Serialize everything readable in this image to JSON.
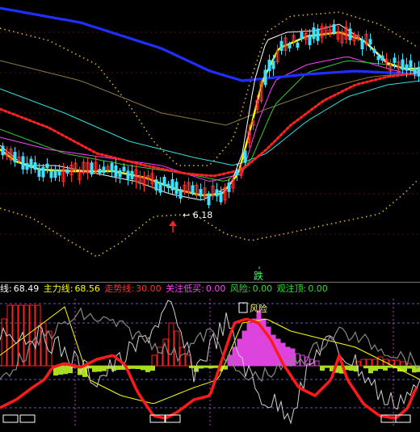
{
  "chart_data": [
    {
      "type": "candlestick",
      "panel": "price",
      "annotations": {
        "low_price_label": "6.18",
        "marker_label": "跌"
      },
      "colors": {
        "up": "#ff3333",
        "down": "#40e0ff",
        "ma_long": "#1f2fff",
        "ma_yellow": "#ffff00",
        "ma_white": "#ffffff",
        "ma_magenta": "#ff40ff",
        "ma_green": "#33cc33",
        "ma_cyan": "#33dddd",
        "dots_red": "#ff2222",
        "dots_yellow": "#d9b030"
      }
    },
    {
      "type": "line",
      "panel": "indicator",
      "legend": [
        {
          "label": "线:",
          "value": "68.49",
          "color": "#ffffff"
        },
        {
          "label": "主力线:",
          "value": "68.56",
          "color": "#ffff00"
        },
        {
          "label": "走势线:",
          "value": "30.00",
          "color": "#ff3030"
        },
        {
          "label": "关注低买:",
          "value": "0.00",
          "color": "#ff40ff"
        },
        {
          "label": "风险:",
          "value": "0.00",
          "color": "#33dd33"
        },
        {
          "label": "观注顶:",
          "value": "0.00",
          "color": "#33dd33"
        }
      ],
      "annotations": {
        "risk_label": "风险"
      },
      "ylim": [
        0,
        100
      ]
    }
  ]
}
